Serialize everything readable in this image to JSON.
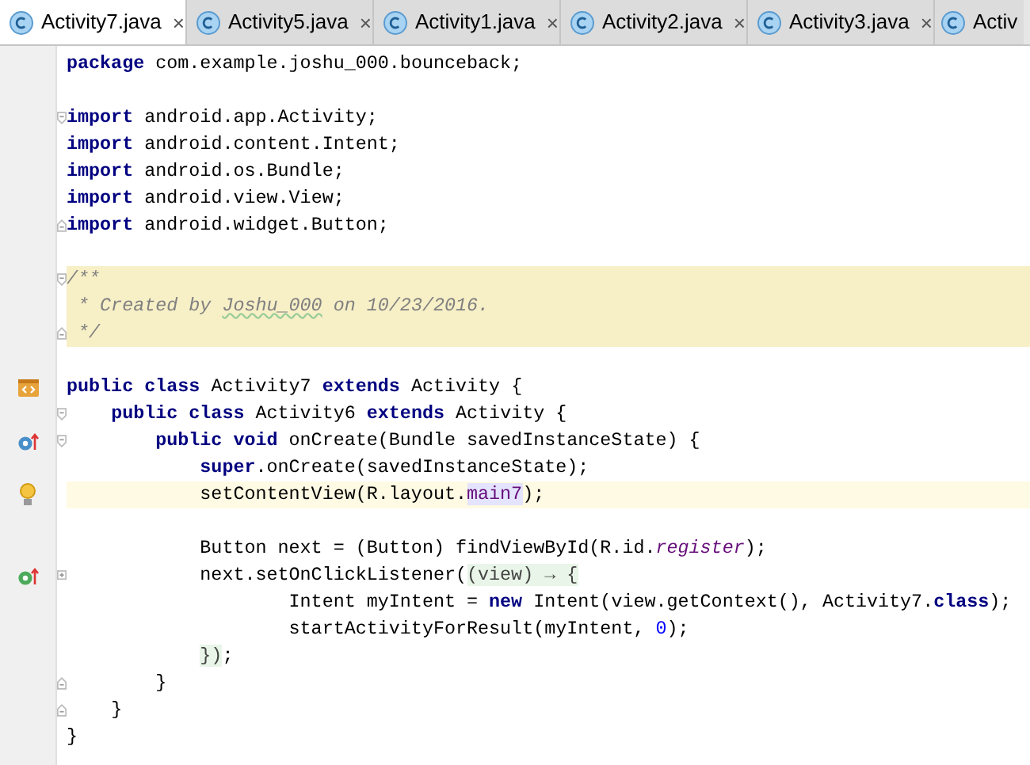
{
  "tabs": [
    {
      "label": "Activity7.java",
      "selected": true,
      "close": "×"
    },
    {
      "label": "Activity5.java",
      "selected": false,
      "close": "×"
    },
    {
      "label": "Activity1.java",
      "selected": false,
      "close": "×"
    },
    {
      "label": "Activity2.java",
      "selected": false,
      "close": "×"
    },
    {
      "label": "Activity3.java",
      "selected": false,
      "close": "×"
    },
    {
      "label": "Activ",
      "selected": false
    }
  ],
  "editor": {
    "lines": [
      {
        "kind": "code",
        "current": false,
        "segments": [
          {
            "kind": "kw",
            "text": "package"
          },
          {
            "kind": "p",
            "text": " com.example.joshu_000.bounceback;"
          }
        ]
      },
      {
        "kind": "blank"
      },
      {
        "kind": "code",
        "current": false,
        "fold": {
          "kind": "start"
        },
        "segments": [
          {
            "kind": "kw",
            "text": "import"
          },
          {
            "kind": "p",
            "text": " android.app.Activity;"
          }
        ]
      },
      {
        "kind": "code",
        "current": false,
        "segments": [
          {
            "kind": "kw",
            "text": "import"
          },
          {
            "kind": "p",
            "text": " android.content.Intent;"
          }
        ]
      },
      {
        "kind": "code",
        "current": false,
        "segments": [
          {
            "kind": "kw",
            "text": "import"
          },
          {
            "kind": "p",
            "text": " android.os.Bundle;"
          }
        ]
      },
      {
        "kind": "code",
        "current": false,
        "segments": [
          {
            "kind": "kw",
            "text": "import"
          },
          {
            "kind": "p",
            "text": " android.view.View;"
          }
        ]
      },
      {
        "kind": "code",
        "current": false,
        "fold": {
          "kind": "end"
        },
        "segments": [
          {
            "kind": "kw",
            "text": "import"
          },
          {
            "kind": "p",
            "text": " android.widget.Button;"
          }
        ]
      },
      {
        "kind": "blank"
      },
      {
        "kind": "doc",
        "current": false,
        "fold": {
          "kind": "start"
        },
        "segments": [
          {
            "kind": "c",
            "text": "/**"
          }
        ]
      },
      {
        "kind": "doc",
        "current": false,
        "segments": [
          {
            "kind": "c",
            "text": " * Created by "
          },
          {
            "kind": "typo",
            "text": "Joshu_000"
          },
          {
            "kind": "c",
            "text": " on 10/23/2016."
          }
        ]
      },
      {
        "kind": "doc",
        "current": false,
        "fold": {
          "kind": "end"
        },
        "segments": [
          {
            "kind": "c",
            "text": " */"
          }
        ]
      },
      {
        "kind": "blank"
      },
      {
        "kind": "code",
        "current": false,
        "marker": {
          "kind": "layout"
        },
        "segments": [
          {
            "kind": "kw",
            "text": "public class"
          },
          {
            "kind": "p",
            "text": " Activity7 "
          },
          {
            "kind": "kw",
            "text": "extends"
          },
          {
            "kind": "p",
            "text": " Activity {"
          }
        ]
      },
      {
        "kind": "code",
        "current": false,
        "fold": {
          "kind": "start"
        },
        "segments": [
          {
            "kind": "kw",
            "text": "    public class"
          },
          {
            "kind": "p",
            "text": " Activity6 "
          },
          {
            "kind": "kw",
            "text": "extends"
          },
          {
            "kind": "p",
            "text": " Activity {"
          }
        ]
      },
      {
        "kind": "code",
        "current": false,
        "fold": {
          "kind": "start"
        },
        "marker": {
          "kind": "override"
        },
        "segments": [
          {
            "kind": "kw",
            "text": "        public void"
          },
          {
            "kind": "p",
            "text": " onCreate(Bundle savedInstanceState) {"
          }
        ]
      },
      {
        "kind": "code",
        "current": false,
        "segments": [
          {
            "kind": "kw",
            "text": "            super"
          },
          {
            "kind": "p",
            "text": ".onCreate(savedInstanceState);"
          }
        ]
      },
      {
        "kind": "code",
        "current": true,
        "marker": {
          "kind": "bulb"
        },
        "segments": [
          {
            "kind": "p",
            "text": "            setContentView(R.layout."
          },
          {
            "kind": "ref",
            "text": "main7"
          },
          {
            "kind": "p",
            "text": ");"
          }
        ]
      },
      {
        "kind": "blank"
      },
      {
        "kind": "code",
        "current": false,
        "segments": [
          {
            "kind": "p",
            "text": "            Button next = (Button) findViewById(R.id."
          },
          {
            "kind": "field",
            "text": "register"
          },
          {
            "kind": "p",
            "text": ");"
          }
        ]
      },
      {
        "kind": "code",
        "current": false,
        "fold": {
          "kind": "collapsed"
        },
        "marker": {
          "kind": "implement"
        },
        "segments": [
          {
            "kind": "p",
            "text": "            next.setOnClickListener("
          },
          {
            "kind": "fold",
            "text": "(view) → {"
          }
        ]
      },
      {
        "kind": "code",
        "current": false,
        "segments": [
          {
            "kind": "p",
            "text": "                    Intent myIntent = "
          },
          {
            "kind": "kw",
            "text": "new"
          },
          {
            "kind": "p",
            "text": " Intent(view.getContext(), Activity7."
          },
          {
            "kind": "kw",
            "text": "class"
          },
          {
            "kind": "p",
            "text": ");"
          }
        ]
      },
      {
        "kind": "code",
        "current": false,
        "segments": [
          {
            "kind": "p",
            "text": "                    startActivityForResult(myIntent, "
          },
          {
            "kind": "num",
            "text": "0"
          },
          {
            "kind": "p",
            "text": ");"
          }
        ]
      },
      {
        "kind": "code",
        "current": false,
        "segments": [
          {
            "kind": "fold",
            "text": "            })"
          },
          {
            "kind": "p",
            "text": ";"
          }
        ]
      },
      {
        "kind": "code",
        "current": false,
        "fold": {
          "kind": "end"
        },
        "segments": [
          {
            "kind": "p",
            "text": "        }"
          }
        ]
      },
      {
        "kind": "code",
        "current": false,
        "fold": {
          "kind": "end"
        },
        "segments": [
          {
            "kind": "p",
            "text": "    }"
          }
        ]
      },
      {
        "kind": "code",
        "current": false,
        "segments": [
          {
            "kind": "p",
            "text": "}"
          }
        ]
      }
    ]
  }
}
